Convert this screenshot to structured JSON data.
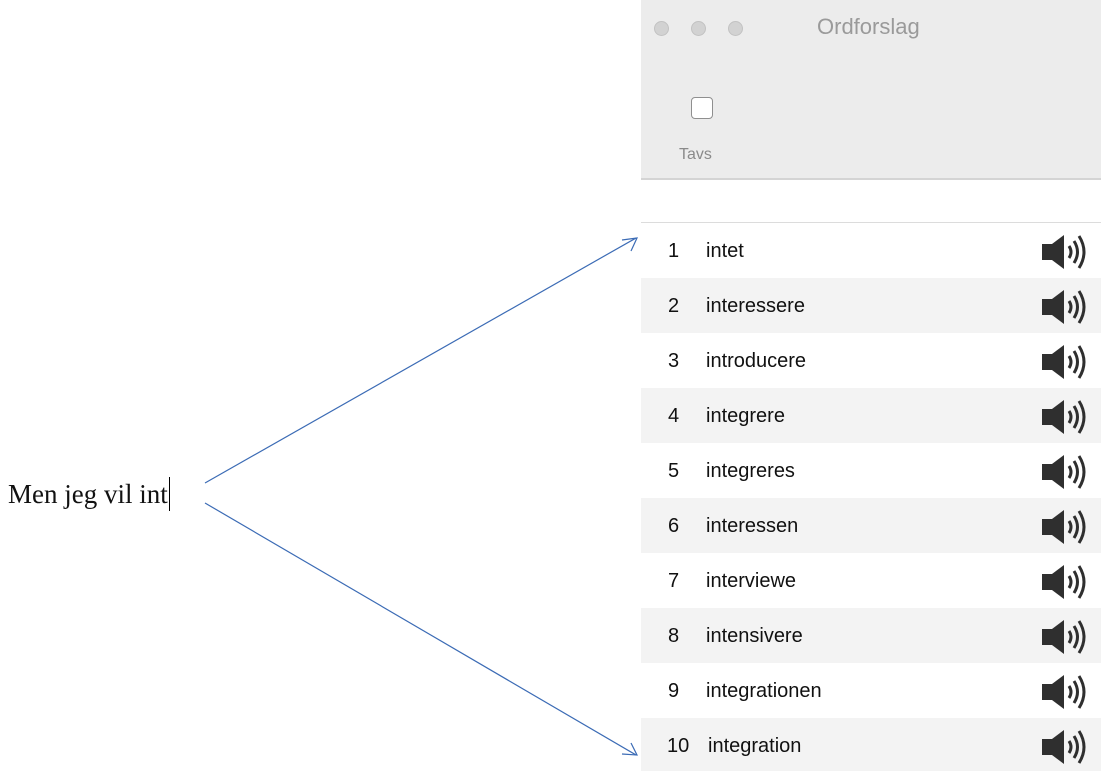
{
  "document": {
    "text": "Men jeg vil int"
  },
  "window": {
    "title": "Ordforslag",
    "mute_label": "Tavs",
    "mute_checked": false
  },
  "suggestions": [
    {
      "number": "1",
      "word": "intet"
    },
    {
      "number": "2",
      "word": "interessere"
    },
    {
      "number": "3",
      "word": "introducere"
    },
    {
      "number": "4",
      "word": "integrere"
    },
    {
      "number": "5",
      "word": "integreres"
    },
    {
      "number": "6",
      "word": "interessen"
    },
    {
      "number": "7",
      "word": "interviewe"
    },
    {
      "number": "8",
      "word": "intensivere"
    },
    {
      "number": "9",
      "word": "integrationen"
    },
    {
      "number": "10",
      "word": "integration"
    }
  ],
  "icons": {
    "speaker": "speaker-icon",
    "arrow": "arrow-annotation"
  },
  "colors": {
    "arrow": "#3b6bb5",
    "titlebar": "#ececec",
    "alt_row": "#f3f3f3",
    "speaker": "#2f2f2f"
  }
}
